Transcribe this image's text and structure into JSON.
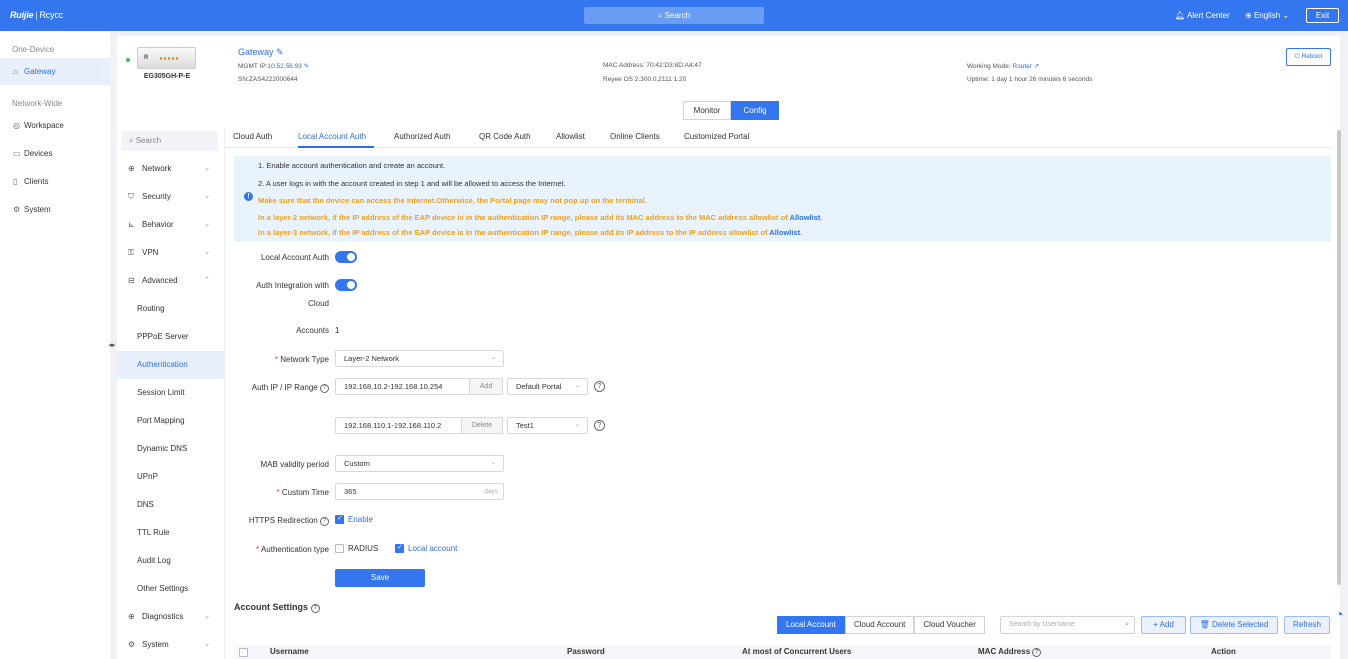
{
  "topbar": {
    "brand": "Ruijie",
    "brand_sub": "Rcycc",
    "search_label": "Search",
    "alert_center": "Alert Center",
    "language": "English",
    "exit": "Exit"
  },
  "nav": {
    "section_one": "One-Device",
    "gateway": "Gateway",
    "section_network": "Network-Wide",
    "workspace": "Workspace",
    "devices": "Devices",
    "clients": "Clients",
    "system": "System"
  },
  "device": {
    "name": "Gateway",
    "model": "EG305GH-P-E",
    "img_label": "R",
    "mgmt_ip_label": "MGMT IP:",
    "mgmt_ip": "10.52.56.93",
    "sn": "SN:ZAS4222000644",
    "mac": "MAC Address: 70:42:D3:8D:A4:47",
    "os": "Reyee OS 2.300.0.2111 1.20",
    "working_mode_label": "Working Mode:",
    "working_mode": "Router",
    "uptime": "Uptime: 1 day 1 hour 26 minutes 6 seconds",
    "reboot": "Reboot"
  },
  "mode": {
    "monitor": "Monitor",
    "config": "Config"
  },
  "submenu": {
    "search": "Search",
    "network": "Network",
    "security": "Security",
    "behavior": "Behavior",
    "vpn": "VPN",
    "advanced": "Advanced",
    "routing": "Routing",
    "pppoe": "PPPoE Server",
    "authentication": "Authentication",
    "session_limit": "Session Limit",
    "port_mapping": "Port Mapping",
    "dynamic_dns": "Dynamic DNS",
    "upnp": "UPnP",
    "dns": "DNS",
    "ttl_rule": "TTL Rule",
    "audit_log": "Audit Log",
    "other_settings": "Other Settings",
    "diagnostics": "Diagnostics",
    "system": "System"
  },
  "tabs": {
    "cloud_auth": "Cloud Auth",
    "local_account_auth": "Local Account Auth",
    "authorized_auth": "Authorized Auth",
    "qr_code_auth": "QR Code Auth",
    "allowlist": "Allowlist",
    "online_clients": "Online Clients",
    "customized_portal": "Customized Portal"
  },
  "notice": {
    "line1": "1. Enable account authentication and create an account.",
    "line2": "2. A user logs in with the account created in step 1 and will be allowed to access the Internet.",
    "warn1": "Make sure that the device can access the Internet.Otherwise, the Portal page may not pop up on the terminal.",
    "warn2": "In a layer-2 network, if the IP address of the EAP device is in the authentication IP range, please add its MAC address to the MAC address allowlist of",
    "warn3": "In a layer-3 network, if the IP address of the EAP device is in the authentication IP range, please add its IP address to the IP address allowlist of",
    "allowlist_link": "Allowlist",
    "period": "."
  },
  "form": {
    "local_account_auth": "Local Account Auth",
    "auth_integration": "Auth Integration with",
    "auth_integration2": "Cloud",
    "accounts_label": "Accounts",
    "accounts_value": "1",
    "network_type_label": "Network Type",
    "network_type": "Layer-2 Network",
    "auth_ip_label": "Auth IP / IP Range",
    "ip_range1": "192.168.10.2-192.168.10.254",
    "add": "Add",
    "portal1": "Default Portal",
    "ip_range2": "192.168.110.1-192.168.110.2",
    "delete": "Delete",
    "portal2": "Test1",
    "mab_label": "MAB validity period",
    "mab_value": "Custom",
    "custom_time_label": "Custom Time",
    "custom_time": "365",
    "custom_time_unit": "days",
    "https_label": "HTTPS Redirection",
    "enable": "Enable",
    "auth_type_label": "Authentication type",
    "radius": "RADIUS",
    "local_account": "Local account",
    "save": "Save"
  },
  "accounts": {
    "title": "Account Settings",
    "local_account": "Local Account",
    "cloud_account": "Cloud Account",
    "cloud_voucher": "Cloud Voucher",
    "search_placeholder": "Search by Username",
    "add": "+ Add",
    "delete_selected": "Delete Selected",
    "refresh": "Refresh",
    "columns": {
      "username": "Username",
      "password": "Password",
      "concurrent": "At most of Concurrent Users",
      "mac": "MAC Address",
      "action": "Action"
    }
  },
  "colors": {
    "accent": "#3376f0",
    "warn": "#f0a020",
    "notice_bg": "#e8f3fd"
  }
}
